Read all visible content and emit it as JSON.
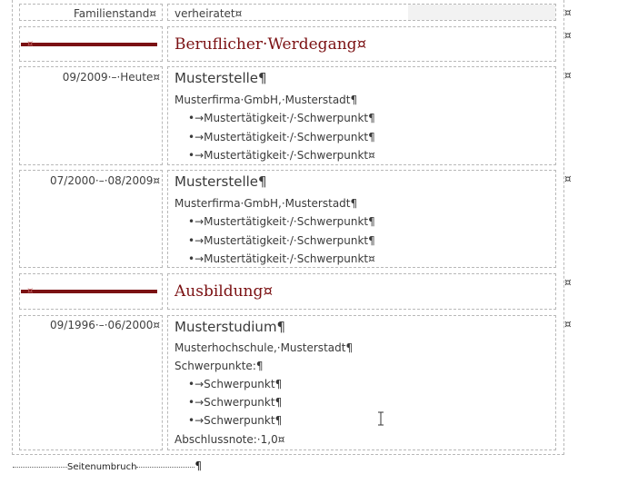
{
  "row_family": {
    "label": "Familienstand¤",
    "value": "verheiratet¤"
  },
  "section_career": {
    "title": "Beruflicher·Werdegang",
    "mark": "¤"
  },
  "job1": {
    "dates": "09/2009·–·Heute¤",
    "title": "Musterstelle¶",
    "company": "Musterfirma·GmbH,·Musterstadt¶",
    "bullets": [
      "•→Mustertätigkeit·/·Schwerpunkt¶",
      "•→Mustertätigkeit·/·Schwerpunkt¶",
      "•→Mustertätigkeit·/·Schwerpunkt¤"
    ]
  },
  "job2": {
    "dates": "07/2000·–·08/2009¤",
    "title": "Musterstelle¶",
    "company": "Musterfirma·GmbH,·Musterstadt¶",
    "bullets": [
      "•→Mustertätigkeit·/·Schwerpunkt¶",
      "•→Mustertätigkeit·/·Schwerpunkt¶",
      "•→Mustertätigkeit·/·Schwerpunkt¤"
    ]
  },
  "section_education": {
    "title": "Ausbildung",
    "mark": "¤"
  },
  "study": {
    "dates": "09/1996·–·06/2000¤",
    "title": "Musterstudium¶",
    "school": "Musterhochschule,·Musterstadt¶",
    "focus_label": "Schwerpunkte:¶",
    "bullets": [
      "•→Schwerpunkt¶",
      "•→Schwerpunkt¶",
      "•→Schwerpunkt¶"
    ],
    "grade": "Abschlussnote:·1,0¤"
  },
  "row_end_mark": "¤",
  "left_section_mark": "¤",
  "page_break": {
    "label": "Seitenumbruch",
    "pilcrow": "¶"
  },
  "colors": {
    "accent": "#7b1113",
    "border": "#b8b8b8"
  }
}
